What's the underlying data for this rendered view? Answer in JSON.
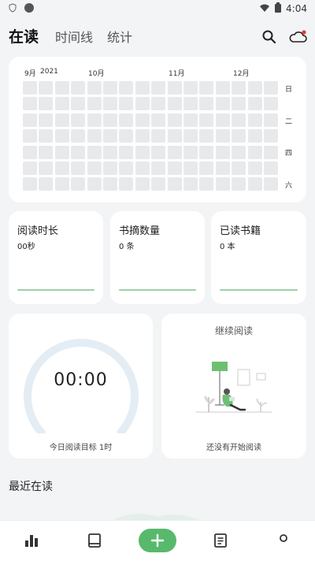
{
  "status_bar": {
    "time": "4:04"
  },
  "header": {
    "tabs": [
      {
        "label": "在读",
        "active": true
      },
      {
        "label": "时间线",
        "active": false
      },
      {
        "label": "统计",
        "active": false
      }
    ],
    "icons": [
      "search-icon",
      "cloud-sync-icon"
    ]
  },
  "heatmap": {
    "months": [
      "9月",
      "2021",
      "10月",
      "11月",
      "12月"
    ],
    "weekdays": [
      "日",
      "二",
      "四",
      "六"
    ],
    "weeks": 16,
    "days": 7
  },
  "stats": [
    {
      "title": "阅读时长",
      "value": "00秒"
    },
    {
      "title": "书摘数量",
      "value": "0 条"
    },
    {
      "title": "已读书籍",
      "value": "0 本"
    }
  ],
  "timer": {
    "time": "00:00",
    "goal_label": "今日阅读目标 1时"
  },
  "continue_reading": {
    "title": "继续阅读",
    "empty_text": "还没有开始阅读"
  },
  "recent": {
    "title": "最近在读"
  },
  "bottom_nav": {
    "items": [
      "stats-icon",
      "book-icon",
      "add-icon",
      "notes-icon",
      "profile-icon"
    ]
  },
  "colors": {
    "accent": "#58b96d",
    "progress_line": "#9ccfa8",
    "ring": "#e4edf4"
  }
}
